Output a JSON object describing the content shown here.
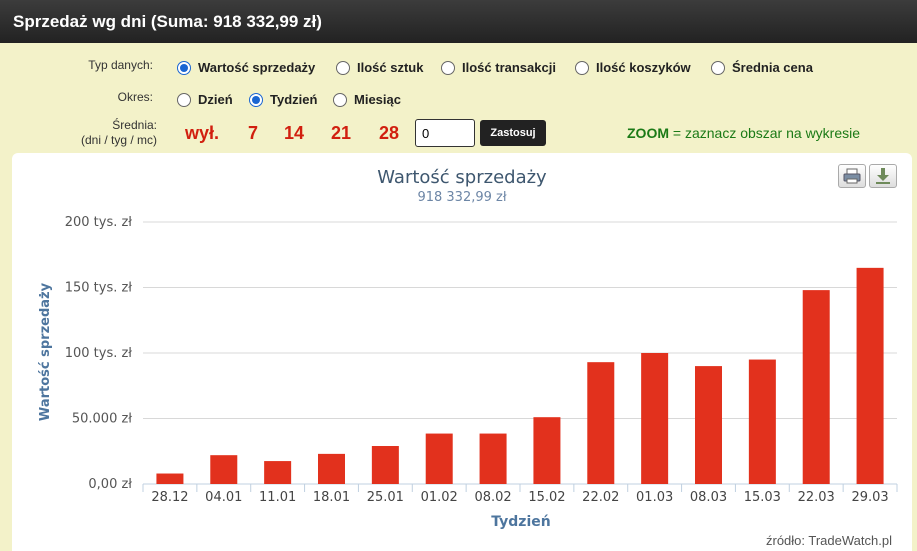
{
  "header": {
    "title": "Sprzedaż wg dni (Suma: 918 332,99 zł)"
  },
  "controls": {
    "data_type_label": "Typ danych:",
    "data_types": [
      {
        "label": "Wartość sprzedaży",
        "selected": true
      },
      {
        "label": "Ilość sztuk",
        "selected": false
      },
      {
        "label": "Ilość transakcji",
        "selected": false
      },
      {
        "label": "Ilość koszyków",
        "selected": false
      },
      {
        "label": "Średnia cena",
        "selected": false
      }
    ],
    "period_label": "Okres:",
    "periods": [
      {
        "label": "Dzień",
        "selected": false
      },
      {
        "label": "Tydzień",
        "selected": true
      },
      {
        "label": "Miesiąc",
        "selected": false
      }
    ],
    "average_label_line1": "Średnia:",
    "average_label_line2": "(dni / tyg / mc)",
    "average_options": [
      "wył.",
      "7",
      "14",
      "21",
      "28"
    ],
    "average_input_value": "0",
    "apply_button": "Zastosuj",
    "zoom_strong": "ZOOM",
    "zoom_text": " = zaznacz obszar na wykresie"
  },
  "icons": {
    "print": "printer-icon",
    "download": "download-icon"
  },
  "source": "źródło: TradeWatch.pl",
  "colors": {
    "bar": "#e2311d",
    "accent": "#1a66d2",
    "zoom": "#1b7a16",
    "avg": "#d11f0f"
  },
  "chart_data": {
    "type": "bar",
    "title": "Wartość sprzedaży",
    "subtitle": "918 332,99 zł",
    "xlabel": "Tydzień",
    "ylabel": "Wartość sprzedaży",
    "ylim": [
      0,
      200000
    ],
    "yticks": [
      0,
      50000,
      100000,
      150000,
      200000
    ],
    "ytick_labels": [
      "0,00 zł",
      "50.000 zł",
      "100 tys. zł",
      "150 tys. zł",
      "200 tys. zł"
    ],
    "categories": [
      "28.12",
      "04.01",
      "11.01",
      "18.01",
      "25.01",
      "01.02",
      "08.02",
      "15.02",
      "22.02",
      "01.03",
      "08.03",
      "15.03",
      "22.03",
      "29.03"
    ],
    "values": [
      8000,
      22000,
      17500,
      23000,
      29000,
      38500,
      38500,
      51000,
      93000,
      100000,
      90000,
      95000,
      148000,
      165000
    ],
    "grid": true,
    "legend": "none"
  }
}
